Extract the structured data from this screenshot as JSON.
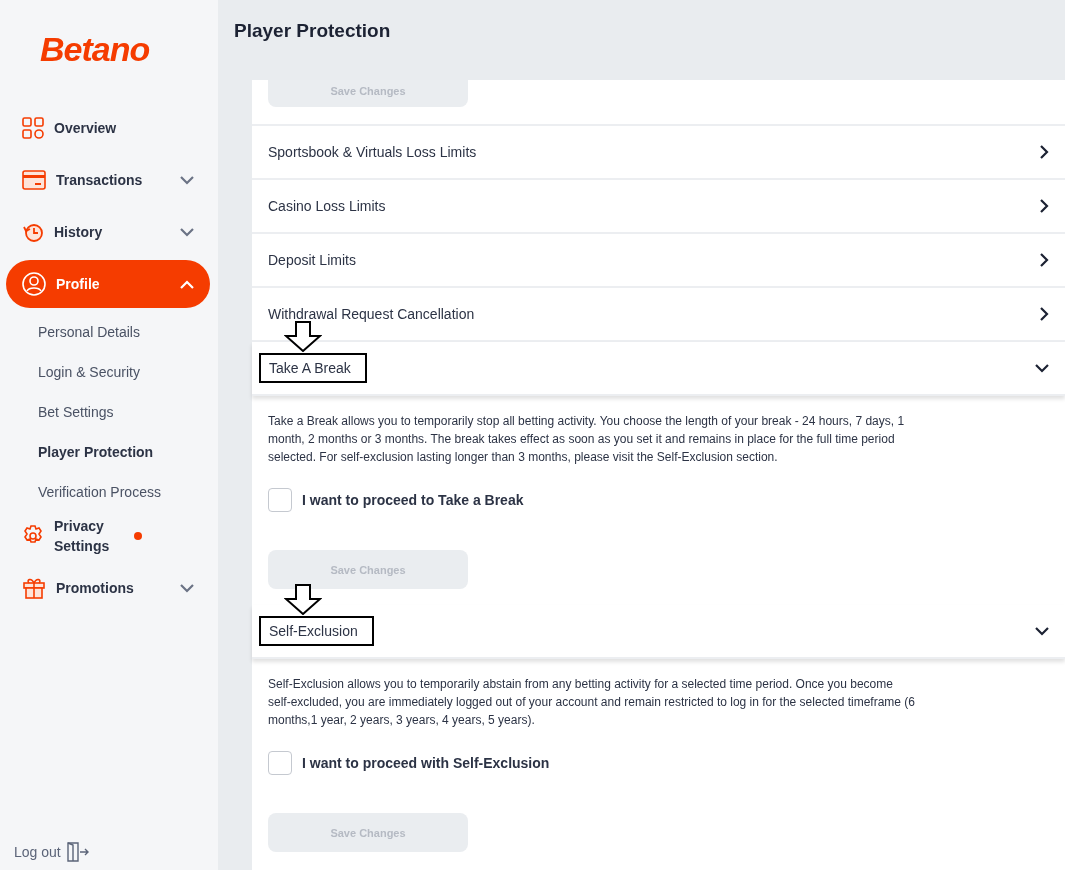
{
  "sidebar": {
    "logo": "Betano",
    "items": [
      {
        "label": "Overview",
        "selected": false
      },
      {
        "label": "Transactions",
        "selected": false,
        "expanded": false
      },
      {
        "label": "History",
        "selected": false,
        "expanded": false
      },
      {
        "label": "Profile",
        "selected": true,
        "expanded": true,
        "children": [
          {
            "label": "Personal Details",
            "selected": false
          },
          {
            "label": "Login & Security",
            "selected": false
          },
          {
            "label": "Bet Settings",
            "selected": false
          },
          {
            "label": "Player Protection",
            "selected": true
          },
          {
            "label": "Verification Process",
            "selected": false
          }
        ]
      },
      {
        "label": "Privacy Settings",
        "selected": false,
        "notification": true
      },
      {
        "label": "Promotions",
        "selected": false,
        "expanded": false
      }
    ],
    "logout": "Log out"
  },
  "page": {
    "title": "Player Protection",
    "top_button": {
      "label": "Save Changes",
      "disabled": true
    },
    "sections": [
      {
        "title": "Sportsbook & Virtuals Loss Limits",
        "expanded": false,
        "highlighted": false
      },
      {
        "title": "Casino Loss Limits",
        "expanded": false,
        "highlighted": false
      },
      {
        "title": "Deposit Limits",
        "expanded": false,
        "highlighted": false
      },
      {
        "title": "Withdrawal Request Cancellation",
        "expanded": false,
        "highlighted": false
      },
      {
        "title": "Take A Break",
        "expanded": true,
        "highlighted": true,
        "description": "Take a Break allows you to temporarily stop all betting activity. You choose the length of your break - 24 hours, 7 days, 1 month, 2 months or 3 months. The break takes effect as soon as you set it and remains in place for the full time period selected. For self-exclusion lasting longer than 3 months, please visit the Self-Exclusion section.",
        "checkbox": {
          "label": "I want to proceed to Take a Break",
          "checked": false
        },
        "button": {
          "label": "Save Changes",
          "disabled": true
        }
      },
      {
        "title": "Self-Exclusion",
        "expanded": true,
        "highlighted": true,
        "description": "Self-Exclusion allows you to temporarily abstain from any betting activity for a selected time period. Once you become self-excluded, you are immediately logged out of your account and remain restricted to log in for the selected timeframe (6 months,1 year, 2 years, 3 years, 4 years, 5 years).",
        "checkbox": {
          "label": "I want to proceed with Self-Exclusion",
          "checked": false
        },
        "button": {
          "label": "Save Changes",
          "disabled": true
        }
      }
    ]
  }
}
